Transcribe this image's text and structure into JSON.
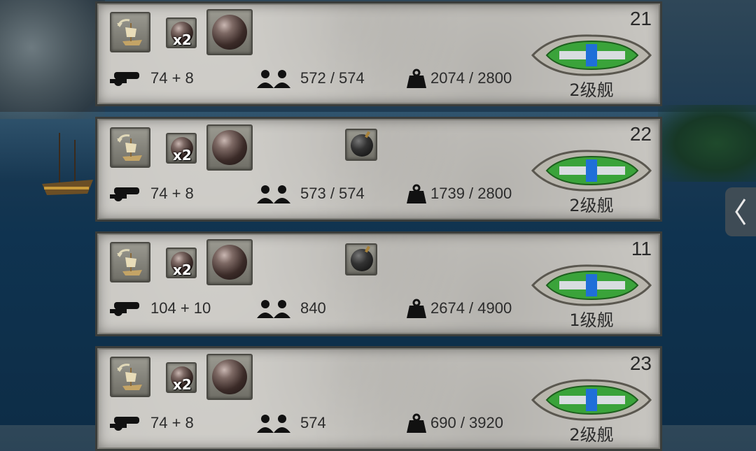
{
  "ships": [
    {
      "number": "21",
      "cannons": "74 + 8",
      "crew": "572 / 574",
      "cargo": "2074 / 2800",
      "rank": "2级舰",
      "has_bomb": false
    },
    {
      "number": "22",
      "cannons": "74 + 8",
      "crew": "573 / 574",
      "cargo": "1739 / 2800",
      "rank": "2级舰",
      "has_bomb": true
    },
    {
      "number": "11",
      "cannons": "104 + 10",
      "crew": "840",
      "cargo": "2674 / 4900",
      "rank": "1级舰",
      "has_bomb": true
    },
    {
      "number": "23",
      "cannons": "74 + 8",
      "crew": "574",
      "cargo": "690 / 3920",
      "rank": "2级舰",
      "has_bomb": false
    }
  ],
  "ammo_multiplier_label": "x2",
  "icons": {
    "reload": "ship-reload-icon",
    "double_shot": "double-shot-icon",
    "cannonball": "cannonball-icon",
    "bomb": "bomb-icon",
    "cannon": "cannon-icon",
    "crew": "crew-icon",
    "cargo": "weight-icon",
    "side_tab": "chevron-left-icon"
  },
  "colors": {
    "card_bg": "#c9c7c2",
    "ship_hull_green": "#3aa33a",
    "ship_center_blue": "#1f6fd8"
  }
}
